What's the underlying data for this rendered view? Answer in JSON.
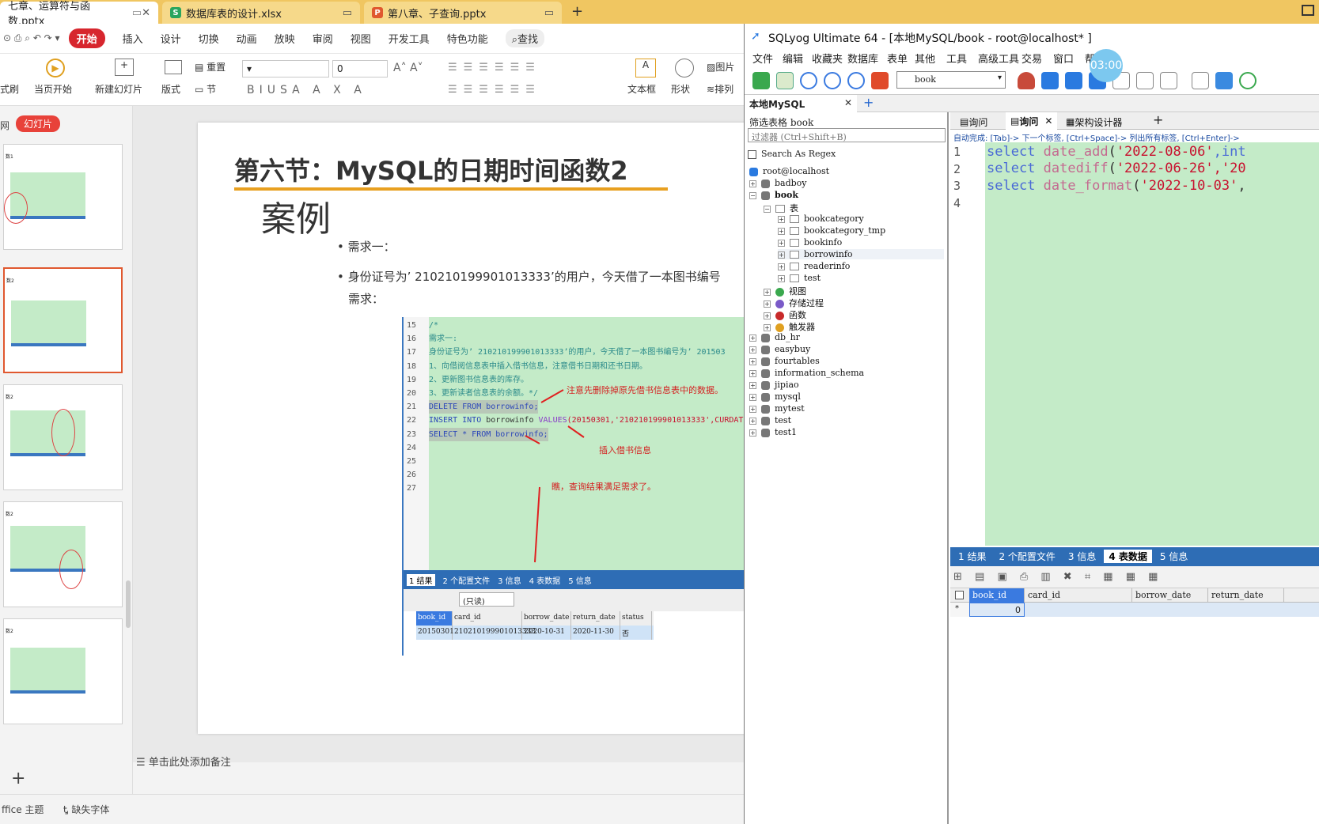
{
  "ppt_tabs": [
    {
      "label": "七章、运算符与函数.pptx",
      "icon": "P",
      "color": "#e0582f"
    },
    {
      "label": "数据库表的设计.xlsx",
      "icon": "S",
      "color": "#2aa55e"
    },
    {
      "label": "第八章、子查询.pptx",
      "icon": "P",
      "color": "#e0582f"
    }
  ],
  "ppt_menu": [
    "开始",
    "插入",
    "设计",
    "切换",
    "动画",
    "放映",
    "审阅",
    "视图",
    "开发工具",
    "特色功能",
    "查找"
  ],
  "ribbon": {
    "style_label": "式刷",
    "play_label": "当页开始",
    "new_slide": "新建幻灯片",
    "layout": "版式",
    "reset": "重置",
    "section": "节",
    "font_size": "0",
    "textbox": "文本框",
    "shape": "形状",
    "picture": "图片",
    "arrange": "排列"
  },
  "panel": {
    "tab_outline": "网",
    "tab_slides": "幻灯片",
    "thumbs": [
      "数1",
      "数2",
      "数2",
      "数2",
      "数2"
    ]
  },
  "slide": {
    "title": "第六节：MySQL的日期时间函数2",
    "subtitle": "案例",
    "bullet1": "需求一：",
    "bullet2": "身份证号为’ 210210199901013333’的用户，今天借了一本图书编号",
    "bullet2b": "需求：",
    "code_lines": [
      "15",
      "16",
      "17",
      "18",
      "19",
      "20",
      "21",
      "22",
      "23",
      "24",
      "25",
      "26",
      "27"
    ],
    "code_text": [
      "/*",
      "需求一:",
      "身份证号为’ 210210199901013333’的用户，今天借了一本图书编号为’ 201503",
      "1、向借阅信息表中插入借书信息，注意借书日期和还书日期。",
      "2、更新图书信息表的库存。",
      "3、更新读者信息表的余额。*/"
    ],
    "sql_delete": "DELETE FROM borrowinfo;",
    "sql_insert_kw": "INSERT INTO",
    "sql_insert_tbl": "borrowinfo",
    "sql_values": "VALUES",
    "sql_insert_args": "(20150301,'210210199901013333',CURDATE()",
    "sql_select": "SELECT * FROM borrowinfo;",
    "note1": "注意先删除掉原先借书信息表中的数据。",
    "note2": "插入借书信息",
    "note3": "瞧，查询结果满足需求了。",
    "result_tabs": [
      "1 结果",
      "2 个配置文件",
      "3 信息",
      "4 表数据",
      "5 信息"
    ],
    "readonly": "(只读)",
    "cols": [
      "book_id",
      "card_id",
      "borrow_date",
      "return_date",
      "status"
    ],
    "row": [
      "20150301",
      "210210199901013333",
      "2020-10-31",
      "2020-11-30",
      "否"
    ]
  },
  "ppt_status": {
    "notes": "单击此处添加备注",
    "theme": "ffice 主题",
    "font": "缺失字体"
  },
  "sqlyog": {
    "title": "SQLyog Ultimate 64 - [本地MySQL/book - root@localhost* ]",
    "timer": "03:00",
    "menu": [
      "文件",
      "编辑",
      "收藏夹",
      "数据库",
      "表单",
      "其他",
      "工具",
      "高级工具",
      "交易",
      "窗口",
      "帮助"
    ],
    "db_select": "book",
    "conn_tab": "本地MySQL",
    "filter_label": "筛选表格 book",
    "filter_placeholder": "过滤器 (Ctrl+Shift+B)",
    "regex": "Search As Regex",
    "root": "root@localhost",
    "dbs": [
      "badboy",
      "book",
      "db_hr",
      "easybuy",
      "fourtables",
      "information_schema",
      "jipiao",
      "mysql",
      "mytest",
      "test",
      "test1"
    ],
    "tables_label": "表",
    "tables": [
      "bookcategory",
      "bookcategory_tmp",
      "bookinfo",
      "borrowinfo",
      "readerinfo",
      "test"
    ],
    "other_nodes": [
      "视图",
      "存储过程",
      "函数",
      "触发器"
    ],
    "query_tabs": [
      "询问",
      "询问",
      "架构设计器"
    ],
    "autocomplete": "自动完成: [Tab]-> 下一个标签, [Ctrl+Space]-> 列出所有标签, [Ctrl+Enter]->",
    "lines": [
      "1",
      "2",
      "3",
      "4"
    ],
    "q1": {
      "kw": "select",
      "fn": "date_add",
      "str": "'2022-08-06'",
      "rest": ",int"
    },
    "q2": {
      "kw": "select",
      "fn": "datediff",
      "str": "'2022-06-26'",
      "rest": ",'20"
    },
    "q3": {
      "kw": "select",
      "fn": "date_format",
      "str": "'2022-10-03'",
      "rest": ","
    },
    "result_tabs": [
      "1 结果",
      "2 个配置文件",
      "3 信息",
      "4 表数据",
      "5 信息"
    ],
    "grid_cols": [
      "book_id",
      "card_id",
      "borrow_date",
      "return_date"
    ],
    "grid_row": [
      "*",
      "0"
    ]
  }
}
